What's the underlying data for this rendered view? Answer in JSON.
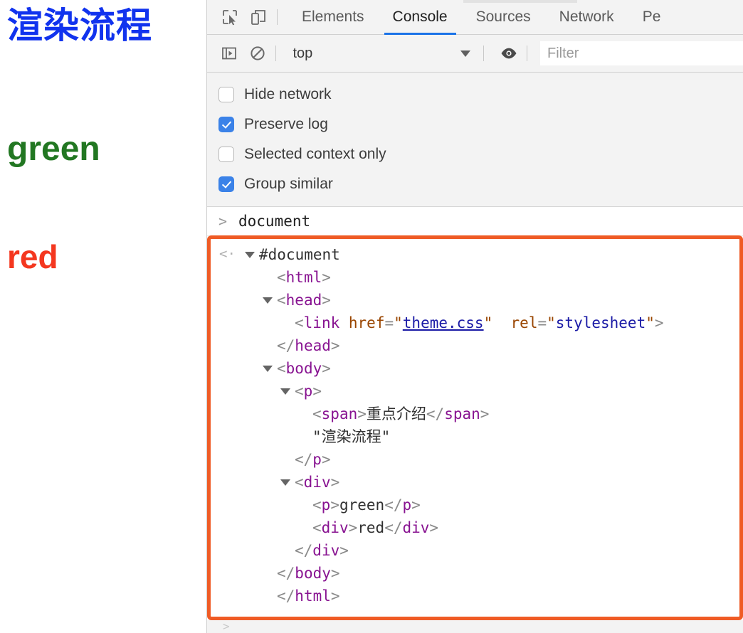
{
  "rendered_page": {
    "heading": "渲染流程",
    "heading_color": "#1133ee",
    "green_text": "green",
    "green_color": "#227722",
    "red_text": "red",
    "red_color": "#f4371f"
  },
  "devtools": {
    "icons": {
      "inspect": "inspect-element-icon",
      "device": "device-toolbar-icon",
      "sidebar": "console-sidebar-icon",
      "clear": "clear-console-icon",
      "eye": "live-expression-eye-icon"
    },
    "tabs": [
      {
        "label": "Elements",
        "active": false
      },
      {
        "label": "Console",
        "active": true
      },
      {
        "label": "Sources",
        "active": false
      },
      {
        "label": "Network",
        "active": false
      },
      {
        "label": "Pe",
        "active": false
      }
    ],
    "toolbar": {
      "context_value": "top",
      "filter_placeholder": "Filter",
      "filter_value": ""
    },
    "settings": [
      {
        "label": "Hide network",
        "checked": false
      },
      {
        "label": "Preserve log",
        "checked": true
      },
      {
        "label": "Selected context only",
        "checked": false
      },
      {
        "label": "Group similar",
        "checked": true
      }
    ],
    "console": {
      "prompt_symbol": ">",
      "input_expression": "document",
      "return_symbol": "<·",
      "highlight_color": "#ef5b25",
      "result_lines": [
        {
          "indent": 0,
          "triangle": true,
          "parts": [
            {
              "t": "#document",
              "c": "nodename"
            }
          ]
        },
        {
          "indent": 1,
          "triangle": false,
          "parts": [
            {
              "t": "<",
              "c": "brk"
            },
            {
              "t": "html",
              "c": "tagname"
            },
            {
              "t": ">",
              "c": "brk"
            }
          ]
        },
        {
          "indent": 1,
          "triangle": true,
          "parts": [
            {
              "t": "<",
              "c": "brk"
            },
            {
              "t": "head",
              "c": "tagname"
            },
            {
              "t": ">",
              "c": "brk"
            }
          ]
        },
        {
          "indent": 2,
          "triangle": false,
          "parts": [
            {
              "t": "<",
              "c": "brk"
            },
            {
              "t": "link",
              "c": "tagname"
            },
            {
              "t": " ",
              "c": "brk"
            },
            {
              "t": "href",
              "c": "attrname"
            },
            {
              "t": "=",
              "c": "brk"
            },
            {
              "t": "\"",
              "c": "attrname"
            },
            {
              "t": "theme.css",
              "c": "attrval lnk"
            },
            {
              "t": "\"",
              "c": "attrname"
            },
            {
              "t": "  ",
              "c": "brk"
            },
            {
              "t": "rel",
              "c": "attrname"
            },
            {
              "t": "=",
              "c": "brk"
            },
            {
              "t": "\"",
              "c": "attrname"
            },
            {
              "t": "stylesheet",
              "c": "attrval"
            },
            {
              "t": "\"",
              "c": "attrname"
            },
            {
              "t": ">",
              "c": "brk"
            }
          ]
        },
        {
          "indent": 1,
          "triangle": false,
          "parts": [
            {
              "t": "</",
              "c": "brk"
            },
            {
              "t": "head",
              "c": "tagname"
            },
            {
              "t": ">",
              "c": "brk"
            }
          ]
        },
        {
          "indent": 1,
          "triangle": true,
          "parts": [
            {
              "t": "<",
              "c": "brk"
            },
            {
              "t": "body",
              "c": "tagname"
            },
            {
              "t": ">",
              "c": "brk"
            }
          ]
        },
        {
          "indent": 2,
          "triangle": true,
          "parts": [
            {
              "t": "<",
              "c": "brk"
            },
            {
              "t": "p",
              "c": "tagname"
            },
            {
              "t": ">",
              "c": "brk"
            }
          ]
        },
        {
          "indent": 3,
          "triangle": false,
          "parts": [
            {
              "t": "<",
              "c": "brk"
            },
            {
              "t": "span",
              "c": "tagname"
            },
            {
              "t": ">",
              "c": "brk"
            },
            {
              "t": "重点介绍",
              "c": "txtnode"
            },
            {
              "t": "</",
              "c": "brk"
            },
            {
              "t": "span",
              "c": "tagname"
            },
            {
              "t": ">",
              "c": "brk"
            }
          ]
        },
        {
          "indent": 3,
          "triangle": false,
          "parts": [
            {
              "t": "\"渲染流程\"",
              "c": "txtnode"
            }
          ]
        },
        {
          "indent": 2,
          "triangle": false,
          "parts": [
            {
              "t": "</",
              "c": "brk"
            },
            {
              "t": "p",
              "c": "tagname"
            },
            {
              "t": ">",
              "c": "brk"
            }
          ]
        },
        {
          "indent": 2,
          "triangle": true,
          "parts": [
            {
              "t": "<",
              "c": "brk"
            },
            {
              "t": "div",
              "c": "tagname"
            },
            {
              "t": ">",
              "c": "brk"
            }
          ]
        },
        {
          "indent": 3,
          "triangle": false,
          "parts": [
            {
              "t": "<",
              "c": "brk"
            },
            {
              "t": "p",
              "c": "tagname"
            },
            {
              "t": ">",
              "c": "brk"
            },
            {
              "t": "green",
              "c": "txtnode"
            },
            {
              "t": "</",
              "c": "brk"
            },
            {
              "t": "p",
              "c": "tagname"
            },
            {
              "t": ">",
              "c": "brk"
            }
          ]
        },
        {
          "indent": 3,
          "triangle": false,
          "parts": [
            {
              "t": "<",
              "c": "brk"
            },
            {
              "t": "div",
              "c": "tagname"
            },
            {
              "t": ">",
              "c": "brk"
            },
            {
              "t": "red",
              "c": "txtnode"
            },
            {
              "t": "</",
              "c": "brk"
            },
            {
              "t": "div",
              "c": "tagname"
            },
            {
              "t": ">",
              "c": "brk"
            }
          ]
        },
        {
          "indent": 2,
          "triangle": false,
          "parts": [
            {
              "t": "</",
              "c": "brk"
            },
            {
              "t": "div",
              "c": "tagname"
            },
            {
              "t": ">",
              "c": "brk"
            }
          ]
        },
        {
          "indent": 1,
          "triangle": false,
          "parts": [
            {
              "t": "</",
              "c": "brk"
            },
            {
              "t": "body",
              "c": "tagname"
            },
            {
              "t": ">",
              "c": "brk"
            }
          ]
        },
        {
          "indent": 1,
          "triangle": false,
          "parts": [
            {
              "t": "</",
              "c": "brk"
            },
            {
              "t": "html",
              "c": "tagname"
            },
            {
              "t": ">",
              "c": "brk"
            }
          ]
        }
      ]
    }
  }
}
